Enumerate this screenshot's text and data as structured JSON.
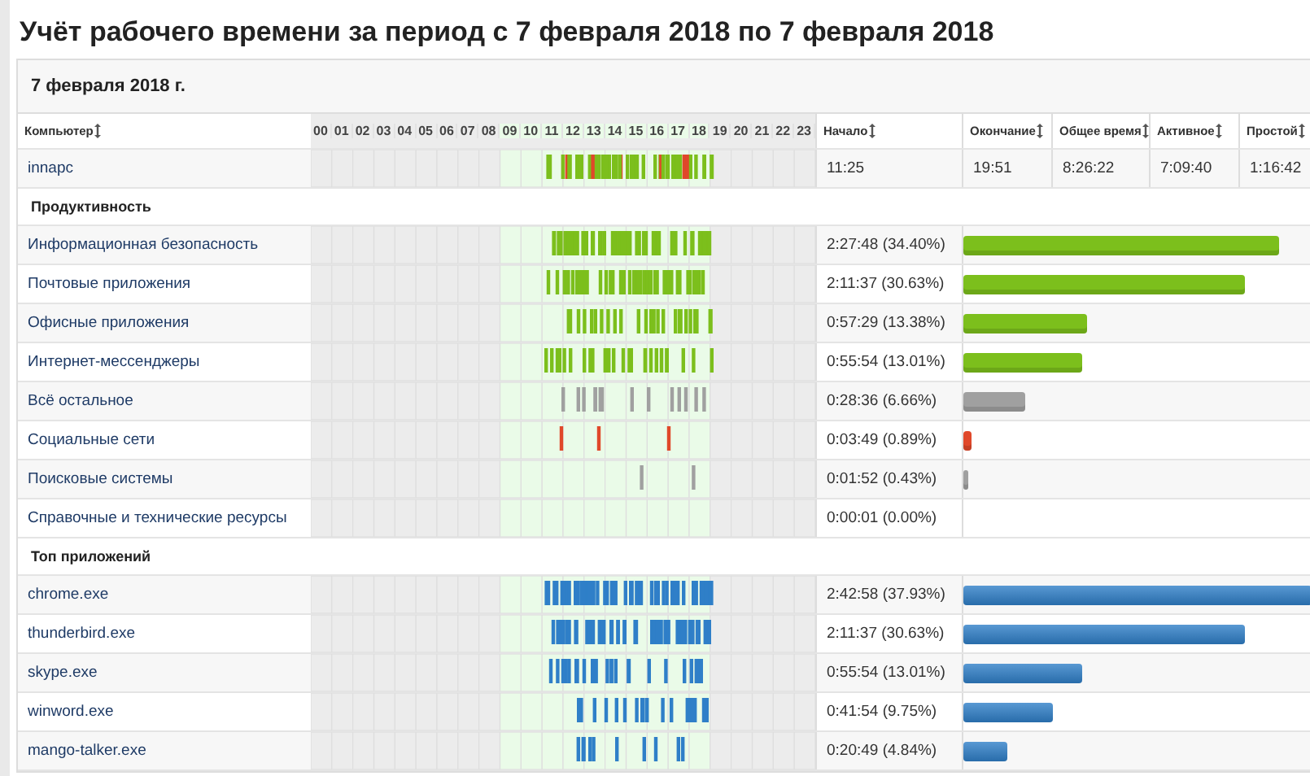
{
  "title": "Учёт рабочего времени за период с 7 февраля 2018 по 7 февраля 2018",
  "date_header": "7 февраля 2018 г.",
  "columns": {
    "computer": "Компьютер",
    "start": "Начало",
    "end": "Окончание",
    "total": "Общее время",
    "active": "Активное",
    "idle": "Простой"
  },
  "hours": [
    {
      "label": "00",
      "highlighted": false
    },
    {
      "label": "01",
      "highlighted": false
    },
    {
      "label": "02",
      "highlighted": false
    },
    {
      "label": "03",
      "highlighted": false
    },
    {
      "label": "04",
      "highlighted": false
    },
    {
      "label": "05",
      "highlighted": false
    },
    {
      "label": "06",
      "highlighted": false
    },
    {
      "label": "07",
      "highlighted": false
    },
    {
      "label": "08",
      "highlighted": false
    },
    {
      "label": "09",
      "highlighted": true
    },
    {
      "label": "10",
      "highlighted": true
    },
    {
      "label": "11",
      "highlighted": true
    },
    {
      "label": "12",
      "highlighted": true
    },
    {
      "label": "13",
      "highlighted": true
    },
    {
      "label": "14",
      "highlighted": true
    },
    {
      "label": "15",
      "highlighted": true
    },
    {
      "label": "16",
      "highlighted": true
    },
    {
      "label": "17",
      "highlighted": true
    },
    {
      "label": "18",
      "highlighted": true
    },
    {
      "label": "19",
      "highlighted": false
    },
    {
      "label": "20",
      "highlighted": false
    },
    {
      "label": "21",
      "highlighted": false
    },
    {
      "label": "22",
      "highlighted": false
    },
    {
      "label": "23",
      "highlighted": false
    }
  ],
  "computers": [
    {
      "name": "innapc",
      "start": "11:25",
      "end": "19:51",
      "total": "8:26:22",
      "active": "7:09:40",
      "idle": "1:16:42"
    }
  ],
  "sections": [
    {
      "title": "Продуктивность",
      "kind": "category",
      "rows": [
        {
          "name": "Информационная безопасность",
          "time": "2:27:48 (34.40%)",
          "level": 0.907,
          "color": "#7cbf1c"
        },
        {
          "name": "Почтовые приложения",
          "time": "2:11:37 (30.63%)",
          "level": 0.808,
          "color": "#7cbf1c"
        },
        {
          "name": "Офисные приложения",
          "time": "0:57:29 (13.38%)",
          "level": 0.353,
          "color": "#7cbf1c"
        },
        {
          "name": "Интернет-мессенджеры",
          "time": "0:55:54 (13.01%)",
          "level": 0.343,
          "color": "#7cbf1c"
        },
        {
          "name": "Всё остальное",
          "time": "0:28:36 (6.66%)",
          "level": 0.176,
          "color": "#a0a0a0"
        },
        {
          "name": "Социальные сети",
          "time": "0:03:49 (0.89%)",
          "level": 0.023,
          "color": "#e0482a"
        },
        {
          "name": "Поисковые системы",
          "time": "0:01:52 (0.43%)",
          "level": 0.011,
          "color": "#a0a0a0"
        },
        {
          "name": "Справочные и технические ресурсы",
          "time": "0:00:01 (0.00%)"
        }
      ]
    },
    {
      "title": "Топ приложений",
      "kind": "app",
      "rows": [
        {
          "name": "chrome.exe",
          "time": "2:42:58 (37.93%)",
          "level": 1,
          "color": "#2f7fc8"
        },
        {
          "name": "thunderbird.exe",
          "time": "2:11:37 (30.63%)",
          "level": 0.808,
          "color": "#2f7fc8"
        },
        {
          "name": "skype.exe",
          "time": "0:55:54 (13.01%)",
          "level": 0.343,
          "color": "#2f7fc8"
        },
        {
          "name": "winword.exe",
          "time": "0:41:54 (9.75%)",
          "level": 0.257,
          "color": "#2f7fc8"
        },
        {
          "name": "mango-talker.exe",
          "time": "0:20:49 (4.84%)",
          "level": 0.128,
          "color": "#2f7fc8"
        }
      ]
    }
  ]
}
